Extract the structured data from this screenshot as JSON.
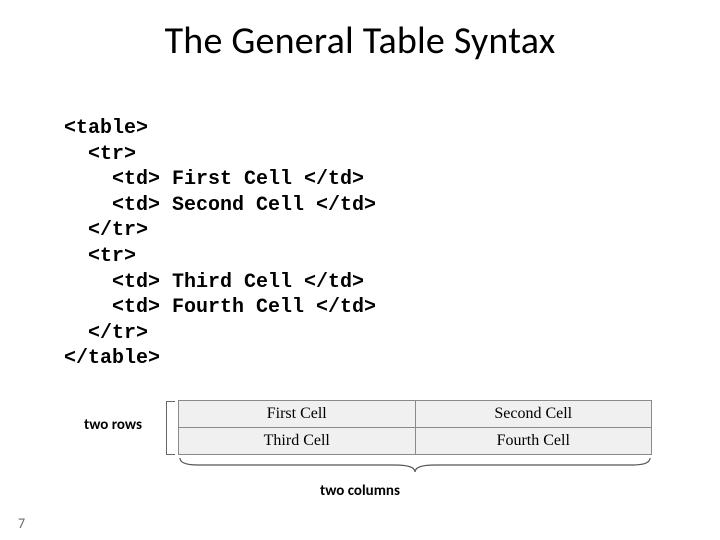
{
  "title": "The General Table Syntax",
  "code_lines": [
    "<table>",
    "  <tr>",
    "    <td> First Cell </td>",
    "    <td> Second Cell </td>",
    "  </tr>",
    "  <tr>",
    "    <td> Third Cell </td>",
    "    <td> Fourth Cell </td>",
    "  </tr>",
    "</table>"
  ],
  "table_cells": {
    "r1c1": "First Cell",
    "r1c2": "Second Cell",
    "r2c1": "Third Cell",
    "r2c2": "Fourth Cell"
  },
  "labels": {
    "rows": "two rows",
    "cols": "two columns"
  },
  "slide_number": "7"
}
